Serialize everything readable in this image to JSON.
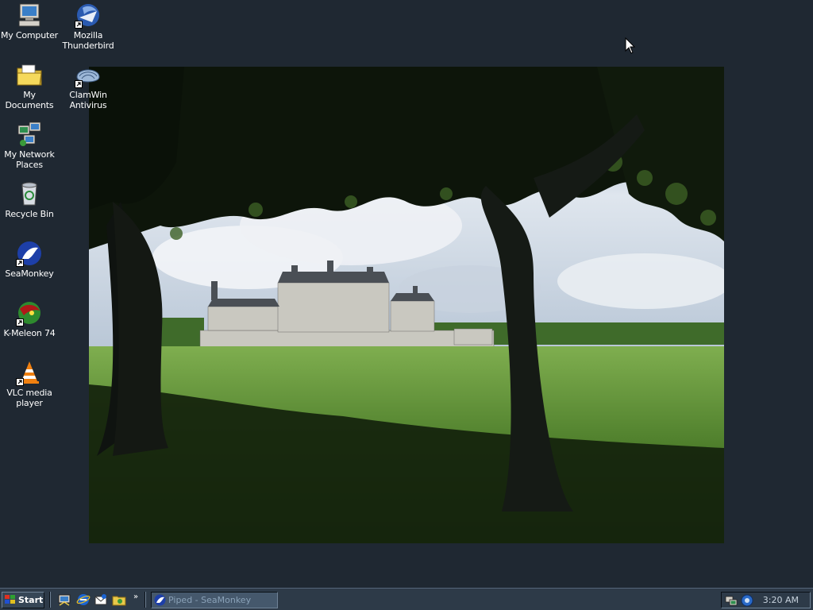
{
  "desktop": {
    "icons": [
      {
        "label": "My Computer",
        "icon": "my-computer-icon",
        "shortcut": false
      },
      {
        "label": "My Documents",
        "icon": "my-documents-icon",
        "shortcut": false
      },
      {
        "label": "My Network Places",
        "icon": "network-places-icon",
        "shortcut": false
      },
      {
        "label": "Recycle Bin",
        "icon": "recycle-bin-icon",
        "shortcut": false
      },
      {
        "label": "SeaMonkey",
        "icon": "seamonkey-icon",
        "shortcut": true
      },
      {
        "label": "K-Meleon 74",
        "icon": "k-meleon-icon",
        "shortcut": true
      },
      {
        "label": "VLC media player",
        "icon": "vlc-icon",
        "shortcut": true
      },
      {
        "label": "Mozilla Thunderbird",
        "icon": "thunderbird-icon",
        "shortcut": true
      },
      {
        "label": "ClamWin Antivirus",
        "icon": "clamwin-icon",
        "shortcut": true
      }
    ],
    "wallpaper": {
      "subject": "chateau-landscape",
      "colors": {
        "sky": "#dfe6ee",
        "grass": "#5f8f3a",
        "shadow": "#0d1209"
      }
    },
    "background_color": "#1f2832"
  },
  "taskbar": {
    "start_label": "Start",
    "quick_launch": [
      {
        "icon": "show-desktop-icon"
      },
      {
        "icon": "internet-explorer-icon"
      },
      {
        "icon": "outlook-express-icon"
      },
      {
        "icon": "media-folder-icon"
      }
    ],
    "quick_launch_more": "»",
    "tasks": [
      {
        "label": "Piped - SeaMonkey",
        "icon": "seamonkey-icon",
        "active": true
      }
    ],
    "tray": {
      "icons": [
        {
          "icon": "network-tray-icon"
        },
        {
          "icon": "clamwin-tray-icon"
        }
      ],
      "clock": "3:20 AM"
    }
  }
}
